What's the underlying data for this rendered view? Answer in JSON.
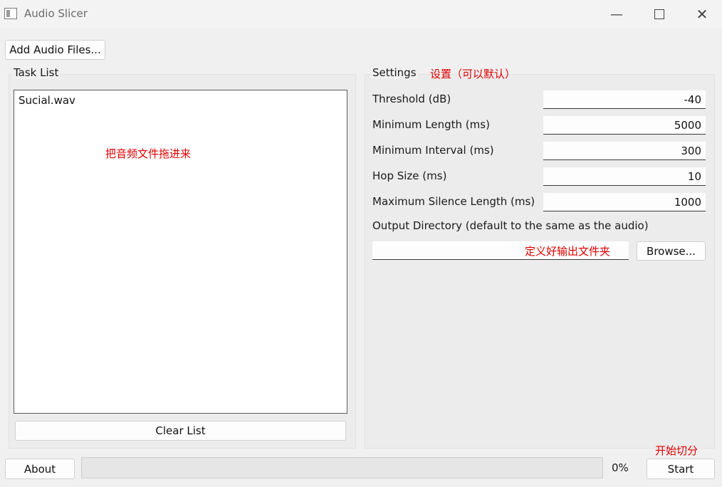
{
  "window": {
    "title": "Audio Slicer",
    "icon": "app-window-icon"
  },
  "toolbar": {
    "add_files_label": "Add Audio Files..."
  },
  "task_list": {
    "label": "Task List",
    "items": [
      "Sucial.wav"
    ],
    "drop_hint": "把音频文件拖进来",
    "clear_label": "Clear List"
  },
  "settings": {
    "label": "Settings",
    "annotation": "设置（可以默认）",
    "fields": [
      {
        "label": "Threshold (dB)",
        "value": "-40"
      },
      {
        "label": "Minimum Length (ms)",
        "value": "5000"
      },
      {
        "label": "Minimum Interval (ms)",
        "value": "300"
      },
      {
        "label": "Hop Size (ms)",
        "value": "10"
      },
      {
        "label": "Maximum Silence Length (ms)",
        "value": "1000"
      }
    ],
    "output_dir_label": "Output Directory (default to the same as the audio)",
    "output_dir_value": "",
    "output_dir_annotation": "定义好输出文件夹",
    "browse_label": "Browse..."
  },
  "footer": {
    "about_label": "About",
    "progress": 0,
    "progress_text": "0%",
    "start_label": "Start",
    "start_annotation": "开始切分"
  },
  "colors": {
    "annotation": "#e00000",
    "window_bg": "#f0f0f0"
  }
}
